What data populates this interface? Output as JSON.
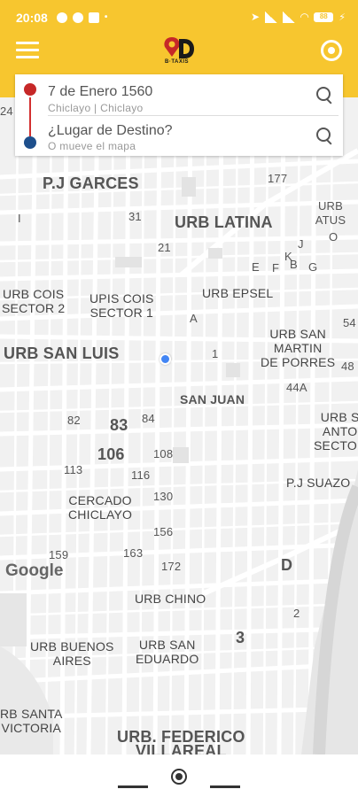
{
  "status_bar": {
    "time": "20:08",
    "battery": "88"
  },
  "header": {
    "logo_text": "B·TAXIS",
    "brand_color": "#f7c62f"
  },
  "origin": {
    "address": "7 de Enero 1560",
    "subtitle": "Chiclayo | Chiclayo"
  },
  "destination": {
    "placeholder": "¿Lugar de Destino?",
    "subtitle": "O mueve el mapa"
  },
  "map": {
    "labels": {
      "pj_garces": "P.J GARCES",
      "urb_latina": "URB LATINA",
      "urb_atus": "URB ATUS",
      "urb_cois_1": "URB COIS",
      "urb_cois_2": "SECTOR 2",
      "upis_cois_1": "UPIS COIS",
      "upis_cois_2": "SECTOR 1",
      "urb_epsel": "URB EPSEL",
      "urb_san_luis": "URB SAN LUIS",
      "urb_smp_1": "URB SAN",
      "urb_smp_2": "MARTIN",
      "urb_smp_3": "DE PORRES",
      "san_juan": "SAN JUAN",
      "urb_santo_1": "URB S",
      "urb_santo_2": "ANTO",
      "urb_santo_3": "SECTOR",
      "pj_suazo": "P.J SUAZO",
      "cercado_1": "CERCADO",
      "cercado_2": "CHICLAYO",
      "urb_chino": "URB CHINO",
      "urb_buenos_1": "URB BUENOS",
      "urb_buenos_2": "AIRES",
      "urb_san_eduardo_1": "URB SAN",
      "urb_san_eduardo_2": "EDUARDO",
      "urb_santa_1": "RB SANTA",
      "urb_santa_2": "VICTORIA",
      "urb_federico_1": "URB. FEDERICO",
      "urb_federico_2": "VILLAREAL"
    },
    "numbers": {
      "n177": "177",
      "n31": "31",
      "n21": "21",
      "n24": "24",
      "ni": "I",
      "nj": "J",
      "no": "O",
      "nk": "K",
      "ne": "E",
      "nf": "F",
      "nb": "B",
      "ng": "G",
      "na": "A",
      "n1": "1",
      "n54": "54",
      "n48": "48",
      "n44a": "44A",
      "n82": "82",
      "n83": "83",
      "n84": "84",
      "n106": "106",
      "n108": "108",
      "n113": "113",
      "n116": "116",
      "n130": "130",
      "n156": "156",
      "n159": "159",
      "n163": "163",
      "n172": "172",
      "nd": "D",
      "n2": "2",
      "n3": "3"
    },
    "attribution": "Google"
  }
}
